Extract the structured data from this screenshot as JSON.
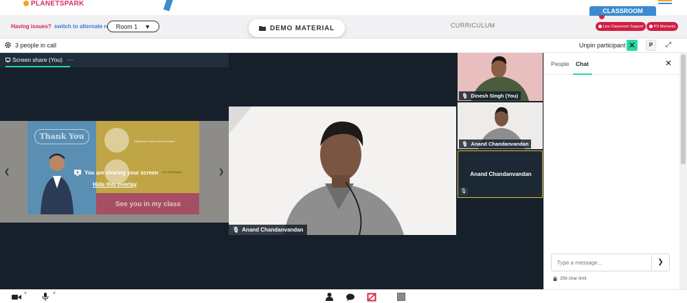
{
  "brand": {
    "logo_text": "PLANETSPARK"
  },
  "header": {
    "issues_text": "Having issues?",
    "alternate_link": "switch to alternate room",
    "room_select": "Room 1",
    "demo_material": "DEMO MATERIAL",
    "curriculum": "CURRICULUM",
    "classroom": "CLASSROOM",
    "live_support": "Live Classroom Support",
    "ps_moments": "PS Moments"
  },
  "callbar": {
    "people_count": "3 people in call",
    "unpin_label": "Unpin participant",
    "p_label": "P"
  },
  "screen_share": {
    "title": "Screen share (You)",
    "more": "···",
    "slide_thank_you": "Thank You",
    "slide_diag_text": "Diagnostic Report will be emailed",
    "slide_partial_text": "nce Champion",
    "slide_see_you": "See you in my class",
    "overlay_message": "You are sharing your screen",
    "hide_overlay": "Hide this overlay"
  },
  "main_tile": {
    "name": "Anand Chandanvandan"
  },
  "tiles": [
    {
      "name": "Dinesh Singh (You)"
    },
    {
      "name": "Anand Chandanvandan"
    },
    {
      "center_name": "Anand Chandanvandan"
    }
  ],
  "panel": {
    "tab_people": "People",
    "tab_chat": "Chat",
    "close": "✕",
    "input_placeholder": "Type a message...",
    "send": "❯",
    "char_limit": "256 char limit"
  },
  "icons": {
    "camera": "camera-icon",
    "mic": "mic-icon",
    "person": "person-icon",
    "chat": "chat-icon",
    "whiteboard": "whiteboard-off-icon",
    "stop": "stop-icon"
  },
  "colors": {
    "accent": "#26d7a6",
    "brand_red": "#cf1f45",
    "classroom_blue": "#3a8ccf",
    "stage_bg": "#15202b"
  }
}
